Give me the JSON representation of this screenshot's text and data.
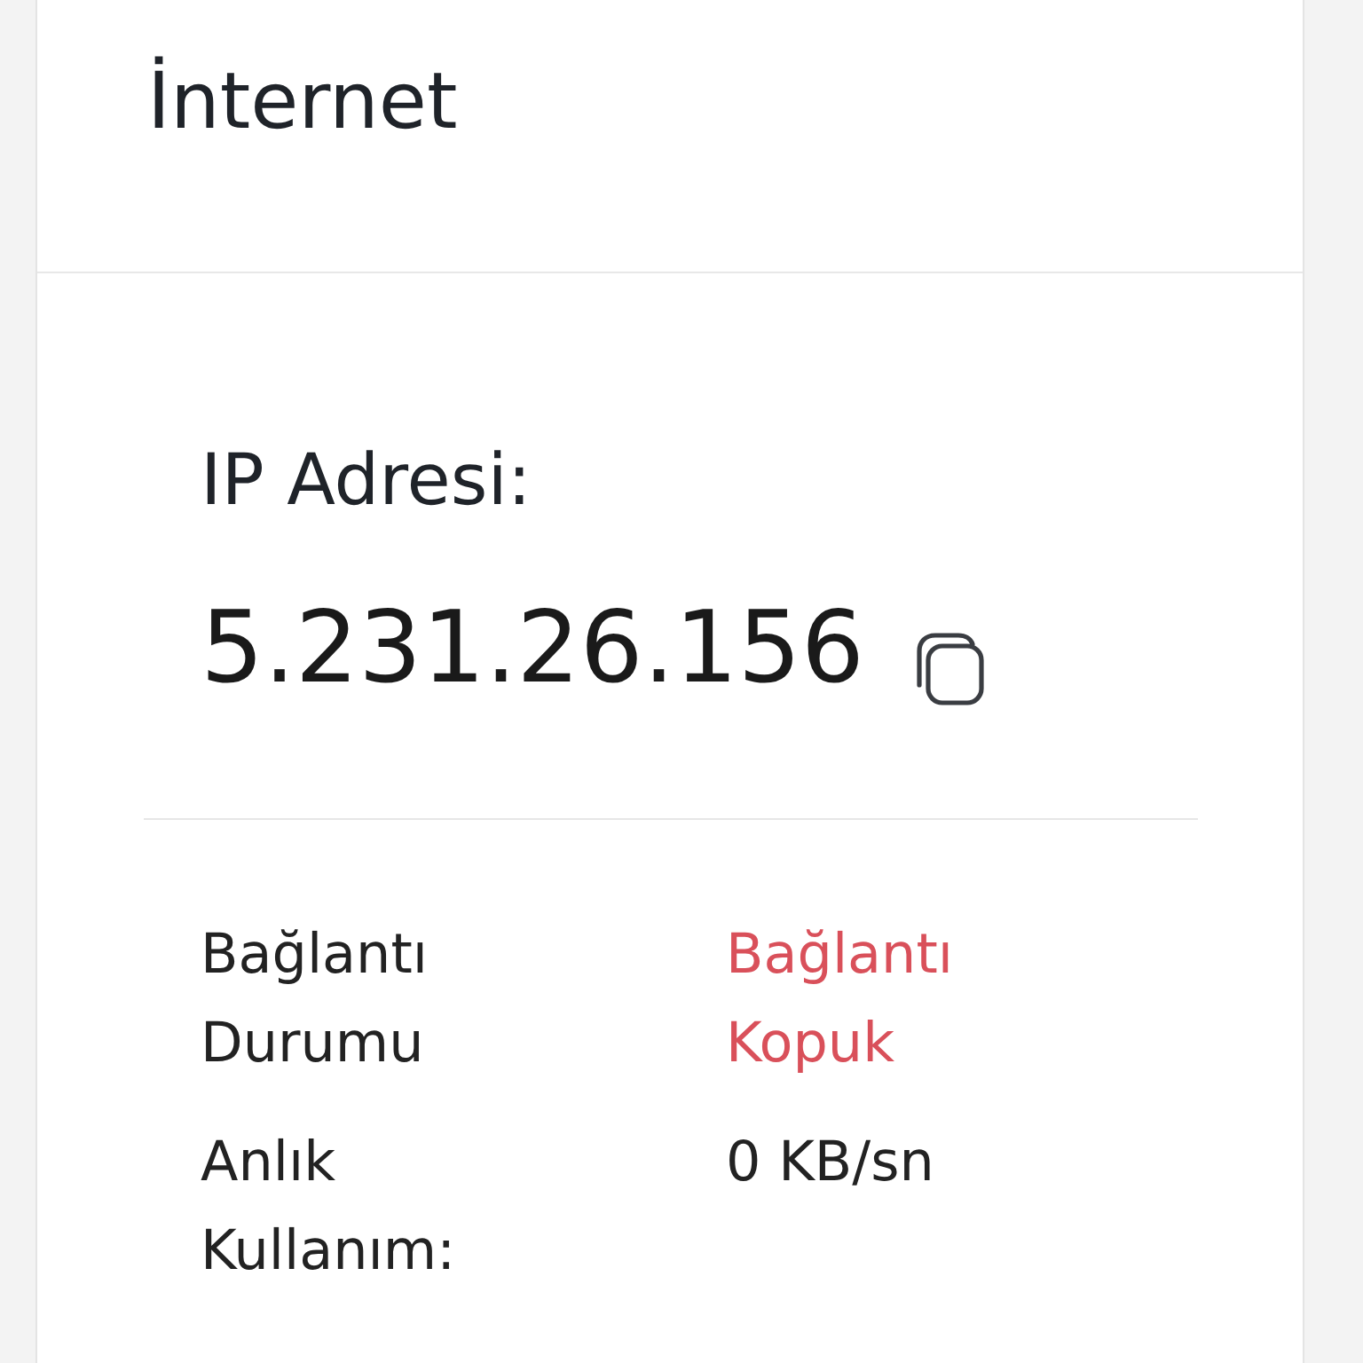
{
  "panel": {
    "title": "İnternet"
  },
  "ip": {
    "label": "IP Adresi:",
    "value": "5.231.26.156"
  },
  "details": [
    {
      "label": "Bağlantı Durumu",
      "value": "Bağlantı Kopuk",
      "color": "#d9505a"
    },
    {
      "label": "Anlık Kullanım:",
      "value": "0 KB/sn",
      "color": "#222222"
    }
  ]
}
